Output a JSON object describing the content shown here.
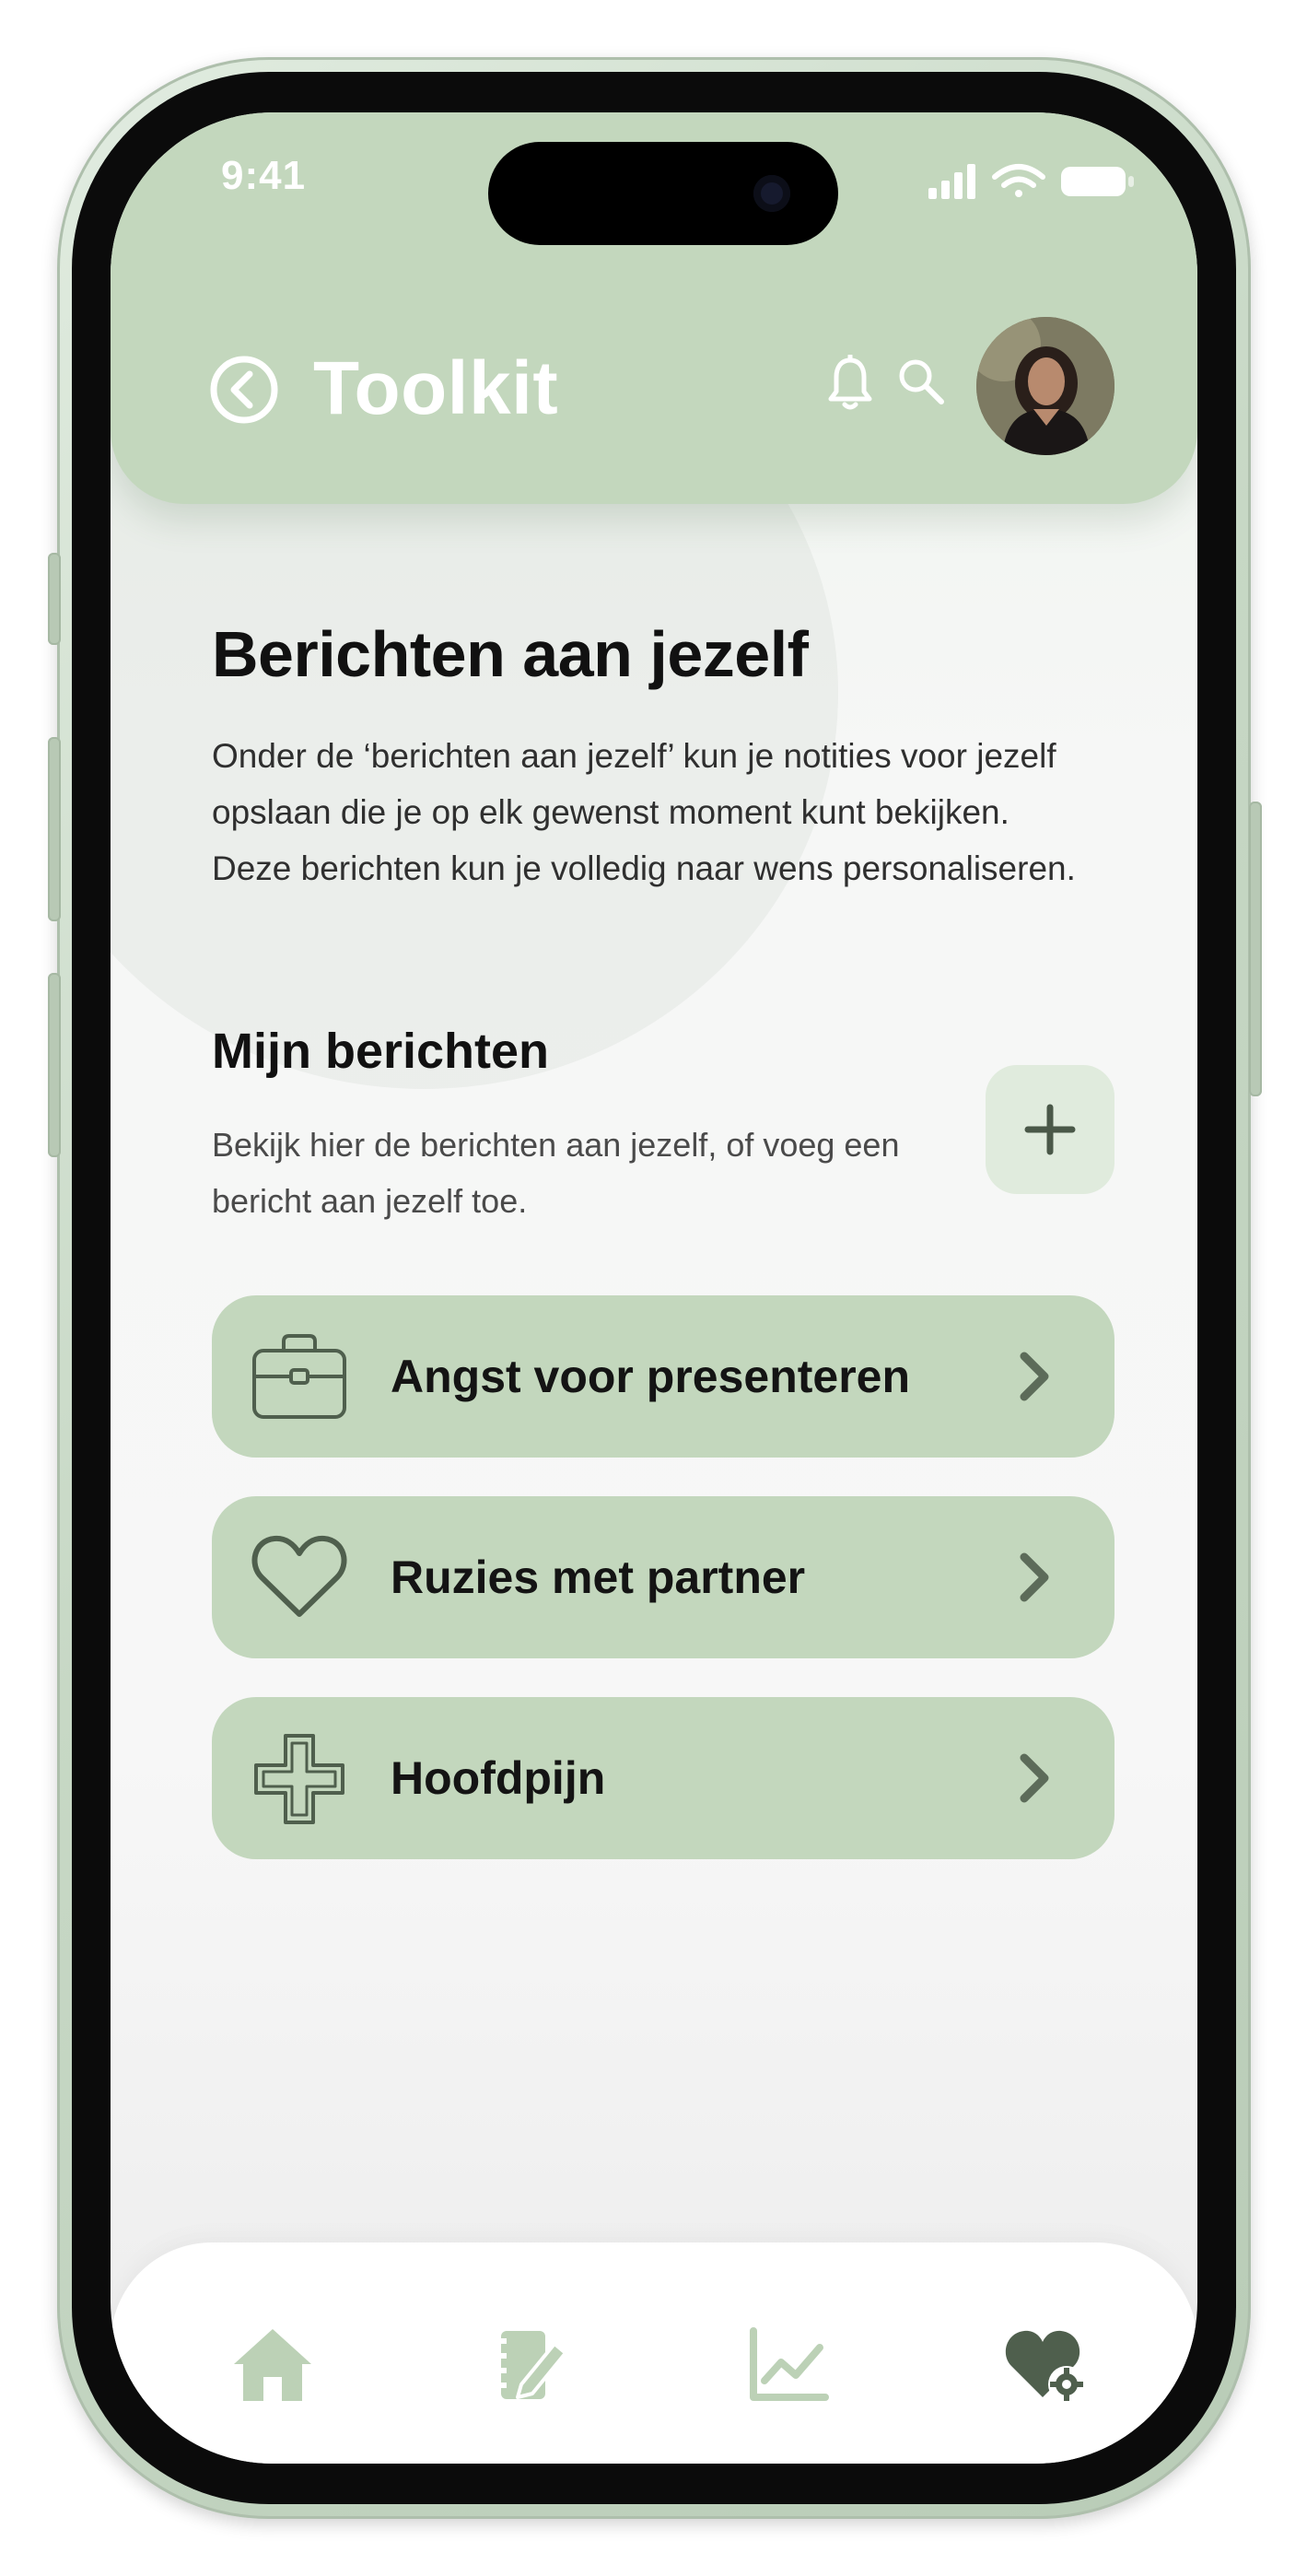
{
  "status_bar": {
    "time": "9:41",
    "icons": [
      "signal-icon",
      "wifi-icon",
      "battery-icon"
    ]
  },
  "header": {
    "title": "Toolkit",
    "icons": [
      "back-circle-icon",
      "bell-icon",
      "search-icon"
    ],
    "background_color": "#c3d7bd"
  },
  "intro": {
    "title": "Berichten aan jezelf",
    "description": "Onder de ‘berichten aan jezelf’ kun je notities voor jezelf opslaan die je op elk gewenst moment kunt bekijken. Deze berichten kun je volledig naar wens personaliseren."
  },
  "messages": {
    "title": "Mijn berichten",
    "description": "Bekijk hier de berichten aan jezelf, of voeg een bericht aan jezelf toe.",
    "add_icon": "plus-icon",
    "items": [
      {
        "label": "Angst voor presenteren",
        "icon": "briefcase-icon"
      },
      {
        "label": "Ruzies met partner",
        "icon": "heart-icon"
      },
      {
        "label": "Hoofdpijn",
        "icon": "medical-cross-icon"
      }
    ]
  },
  "bottom_nav": {
    "items": [
      {
        "icon": "home-icon",
        "active": false
      },
      {
        "icon": "journal-edit-icon",
        "active": false
      },
      {
        "icon": "chart-line-icon",
        "active": false
      },
      {
        "icon": "heart-settings-icon",
        "active": true
      }
    ]
  },
  "colors": {
    "accent": "#c3d7bd",
    "accent_dark": "#4f5f4d",
    "nav_inactive": "#bcd1b6"
  }
}
